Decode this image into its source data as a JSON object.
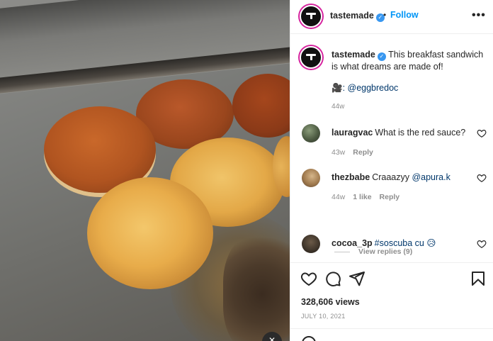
{
  "post": {
    "username": "tastemade",
    "follow_label": "Follow",
    "separator": "•",
    "more_label": "•••",
    "verified_mark": "✓"
  },
  "caption": {
    "username": "tastemade",
    "text": "This breakfast sandwich is what dreams are made of!",
    "credit": "🎥: @eggbredoc",
    "time": "44w"
  },
  "comments": [
    {
      "username": "lauragvac",
      "text": "What is the red sauce?",
      "time": "43w",
      "likes": "",
      "reply": "Reply"
    },
    {
      "username": "thezbabe",
      "text": "Craaazyy ",
      "mention": "@apura.k",
      "time": "44w",
      "likes": "1 like",
      "reply": "Reply"
    },
    {
      "username": "cocoa_3p",
      "text": "",
      "mention": "#soscuba cu 😥",
      "time": "",
      "likes": "",
      "reply": ""
    }
  ],
  "view_replies": "View replies (9)",
  "actions": {
    "views": "328,606 views",
    "date": "JULY 10, 2021"
  },
  "icons": {
    "media_badge": "volume-icon",
    "like": "heart-icon",
    "comment": "comment-icon",
    "share": "share-icon",
    "save": "bookmark-icon",
    "more": "more-icon"
  },
  "colors": {
    "accent": "#0095f6",
    "verified": "#3897f0",
    "text": "#262626",
    "muted": "#8e8e8e"
  }
}
